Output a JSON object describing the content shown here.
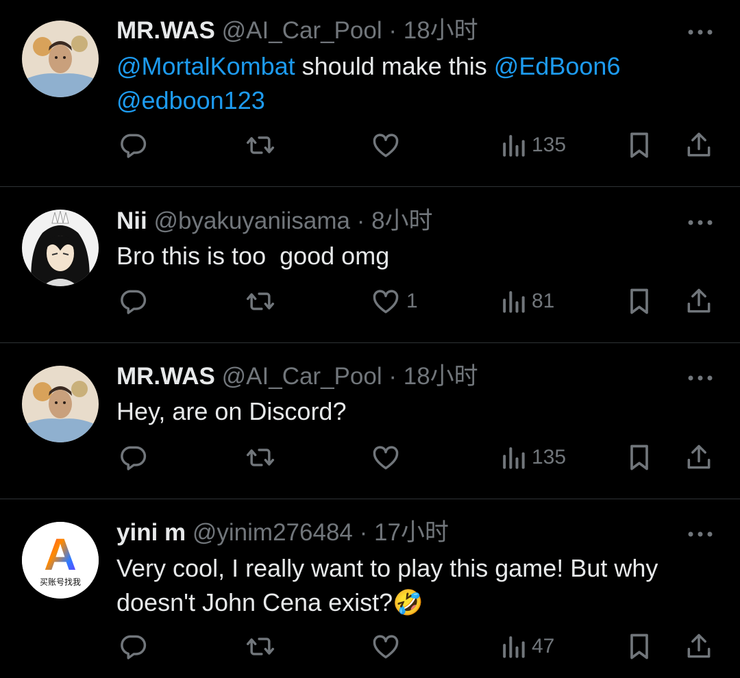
{
  "tweets": [
    {
      "name": "MR.WAS",
      "handle": "@AI_Car_Pool",
      "time": "18小时",
      "mention1": "@MortalKombat",
      "text1": " should make this ",
      "mention2": "@EdBoon6",
      "mention3": "@edboon123",
      "likes": "",
      "views": "135",
      "avatar_icon": "profile-photo-man"
    },
    {
      "name": "Nii",
      "handle": "@byakuyaniisama",
      "time": "8小时",
      "text": "Bro this is too  good omg",
      "likes": "1",
      "views": "81",
      "avatar_icon": "anime-character-avatar"
    },
    {
      "name": "MR.WAS",
      "handle": "@AI_Car_Pool",
      "time": "18小时",
      "text": "Hey, are on Discord?",
      "likes": "",
      "views": "135",
      "avatar_icon": "profile-photo-man"
    },
    {
      "name": "yini m",
      "handle": "@yinim276484",
      "time": "17小时",
      "text_line1": "Very cool, I really want to play this game! But why",
      "text_line2": "doesn't John Cena exist?",
      "emoji": "🤣",
      "likes": "",
      "views": "47",
      "avatar_icon": "letter-a-logo",
      "avatar_logo_letter": "A",
      "avatar_caption": "买账号找我"
    }
  ],
  "colors": {
    "background": "#000000",
    "text": "#e7e9ea",
    "muted": "#71767b",
    "mention": "#1d9bf0",
    "divider": "#2f3336"
  },
  "dot_separator": "·"
}
